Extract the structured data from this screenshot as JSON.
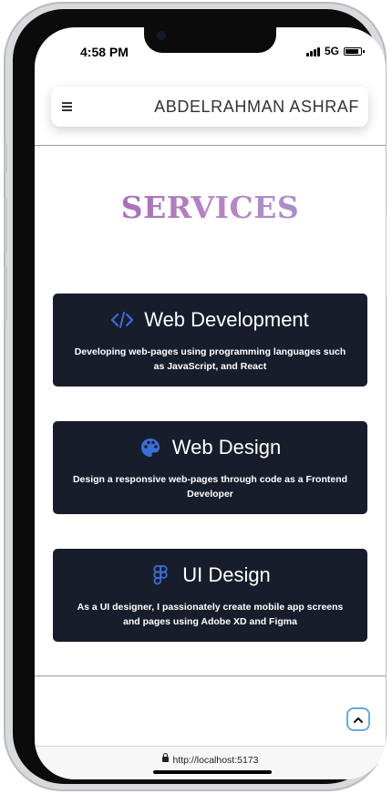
{
  "status_bar": {
    "time": "4:58 PM",
    "network": "5G"
  },
  "navbar": {
    "menu_icon": "hamburger-icon",
    "brand": "ABDELRAHMAN ASHRAF"
  },
  "services": {
    "title": "SERVICES",
    "cards": [
      {
        "icon": "code-icon",
        "title": "Web Development",
        "description": "Developing web-pages using programming languages such as JavaScript, and React"
      },
      {
        "icon": "palette-icon",
        "title": "Web Design",
        "description": "Design a responsive web-pages through code as a Frontend Developer"
      },
      {
        "icon": "figma-icon",
        "title": "UI Design",
        "description": "As a UI designer, I passionately create mobile app screens and pages using Adobe XD and Figma"
      }
    ]
  },
  "scroll_top": {
    "icon": "chevron-up-icon"
  },
  "browser": {
    "url": "http://localhost:5173"
  },
  "colors": {
    "card_bg": "#171d2a",
    "icon_blue": "#3b6fd8",
    "title_gradient_start": "#a05cae",
    "title_gradient_end": "#8f9ed3"
  }
}
